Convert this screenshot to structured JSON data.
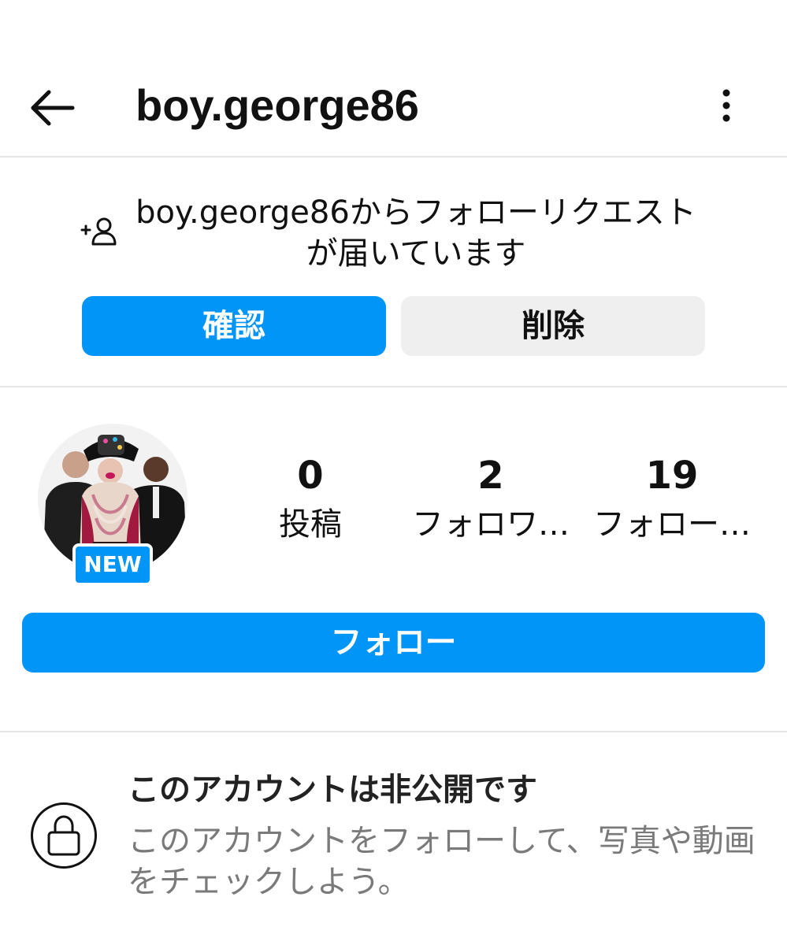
{
  "header": {
    "username": "boy.george86",
    "back_icon": "arrow-left-icon",
    "more_icon": "vertical-ellipsis-icon"
  },
  "request": {
    "icon": "add-person-icon",
    "message": "boy.george86からフォローリクエストが届いています",
    "confirm_label": "確認",
    "delete_label": "削除"
  },
  "profile": {
    "badge": "NEW",
    "stats": [
      {
        "count": "0",
        "label": "投稿"
      },
      {
        "count": "2",
        "label": "フォロワ…"
      },
      {
        "count": "19",
        "label": "フォロー…"
      }
    ],
    "follow_label": "フォロー"
  },
  "private": {
    "icon": "lock-icon",
    "title": "このアカウントは非公開です",
    "description": "このアカウントをフォローして、写真や動画をチェックしよう。"
  },
  "colors": {
    "accent": "#0095f6",
    "secondary_button": "#efefef",
    "divider": "#e6e6e6",
    "muted_text": "#7a7a7a"
  }
}
